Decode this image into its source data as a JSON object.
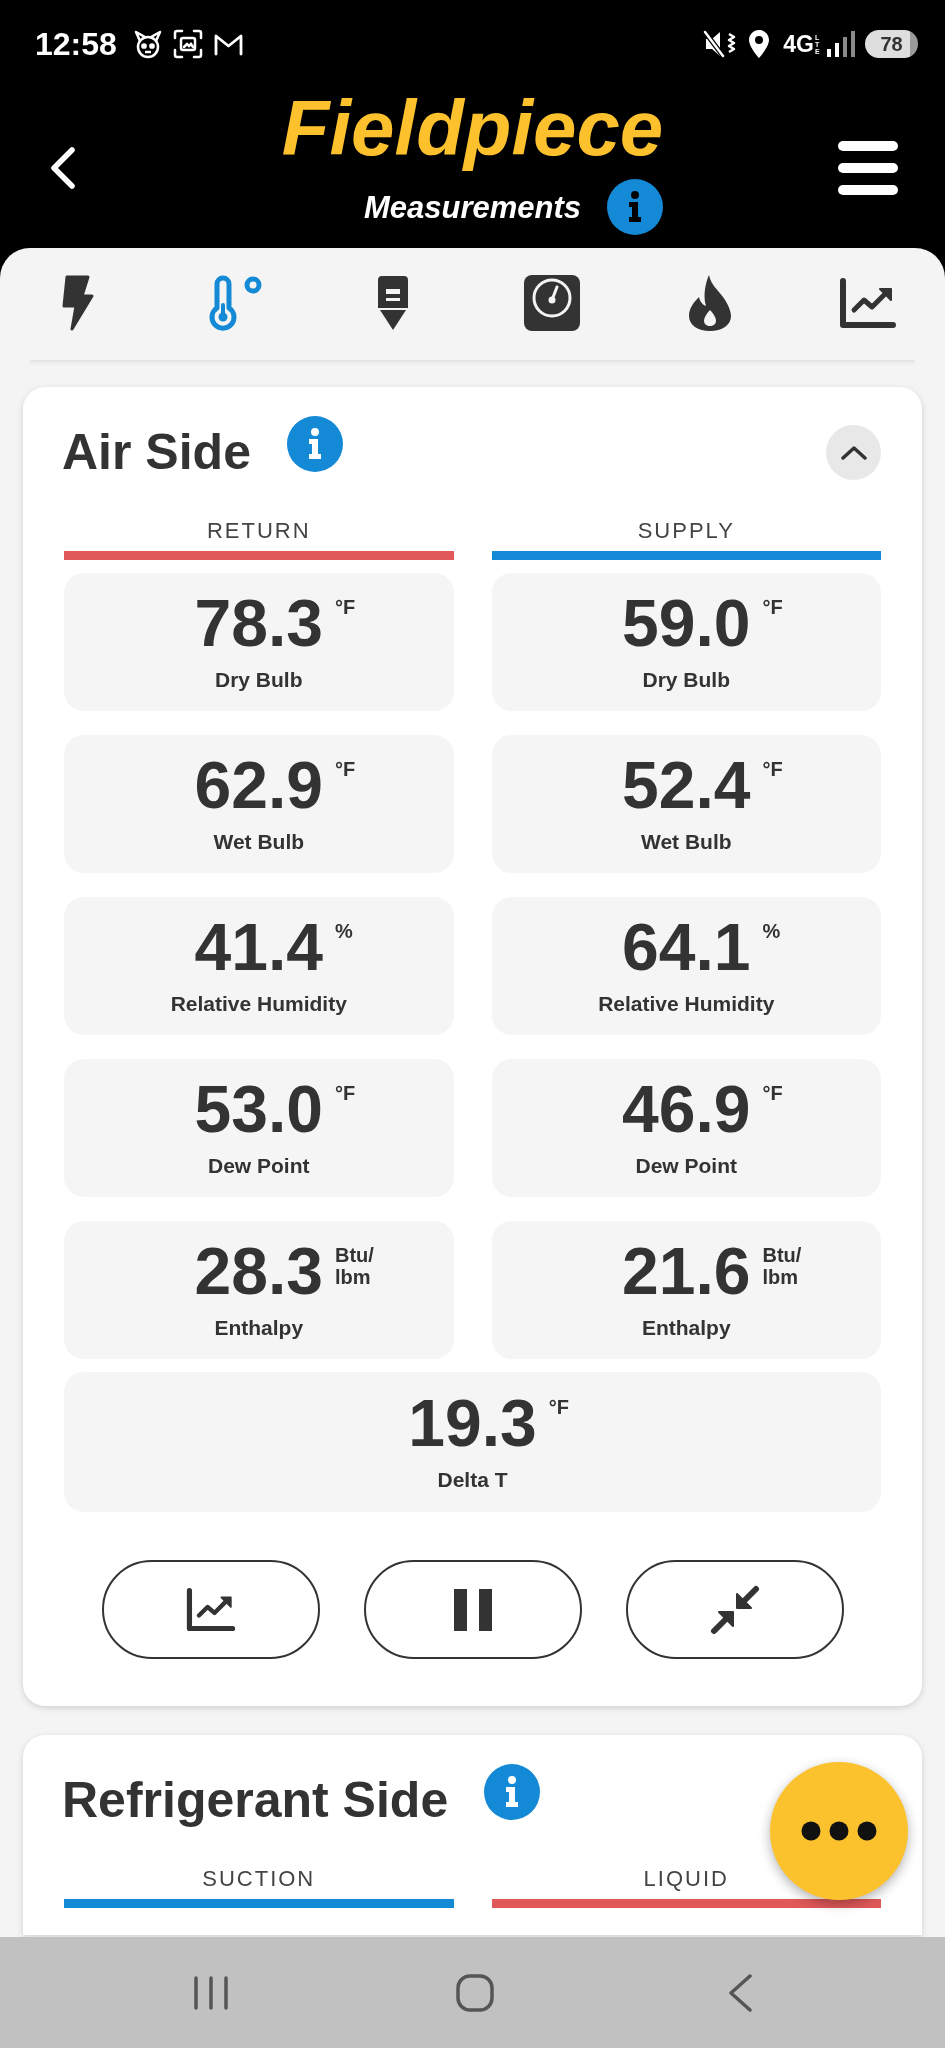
{
  "status_bar": {
    "time": "12:58",
    "network": "4G",
    "network_detail": "LTE",
    "battery": "78"
  },
  "header": {
    "logo": "Fieldpiece",
    "subtitle": "Measurements"
  },
  "tabs": [
    {
      "kind": "bolt",
      "selected": false
    },
    {
      "kind": "thermometer",
      "selected": true
    },
    {
      "kind": "download",
      "selected": false
    },
    {
      "kind": "gauge",
      "selected": false
    },
    {
      "kind": "flame",
      "selected": false
    },
    {
      "kind": "chart",
      "selected": false
    }
  ],
  "sections": [
    {
      "title": "Air Side",
      "expanded": true,
      "columns": [
        {
          "label": "RETURN",
          "color": "#e05858",
          "readings": [
            {
              "value": "78.3",
              "unit": "°F",
              "label": "Dry Bulb"
            },
            {
              "value": "62.9",
              "unit": "°F",
              "label": "Wet Bulb"
            },
            {
              "value": "41.4",
              "unit": "%",
              "label": "Relative Humidity"
            },
            {
              "value": "53.0",
              "unit": "°F",
              "label": "Dew Point"
            },
            {
              "value": "28.3",
              "unit": "Btu/ lbm",
              "label": "Enthalpy"
            }
          ]
        },
        {
          "label": "SUPPLY",
          "color": "#1489d6",
          "readings": [
            {
              "value": "59.0",
              "unit": "°F",
              "label": "Dry Bulb"
            },
            {
              "value": "52.4",
              "unit": "°F",
              "label": "Wet Bulb"
            },
            {
              "value": "64.1",
              "unit": "%",
              "label": "Relative Humidity"
            },
            {
              "value": "46.9",
              "unit": "°F",
              "label": "Dew Point"
            },
            {
              "value": "21.6",
              "unit": "Btu/ lbm",
              "label": "Enthalpy"
            }
          ]
        }
      ],
      "combined": [
        {
          "value": "19.3",
          "unit": "°F",
          "label": "Delta T"
        }
      ],
      "actions": [
        {
          "kind": "chart"
        },
        {
          "kind": "pause"
        },
        {
          "kind": "compress"
        }
      ]
    },
    {
      "title": "Refrigerant Side",
      "columns": [
        {
          "label": "SUCTION",
          "color": "#1489d6"
        },
        {
          "label": "LIQUID",
          "color": "#e05858"
        }
      ]
    }
  ]
}
